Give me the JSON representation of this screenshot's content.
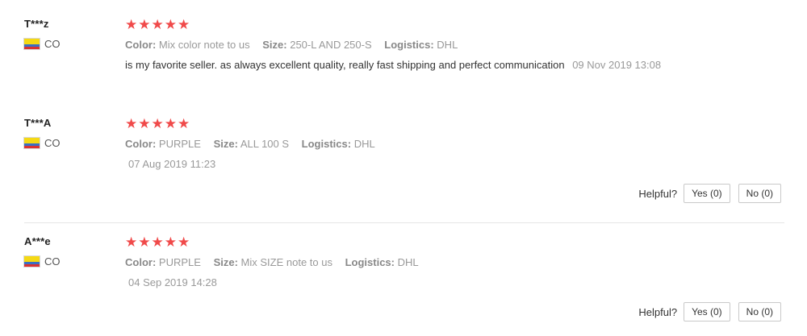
{
  "labels": {
    "color": "Color:",
    "size": "Size:",
    "logistics": "Logistics:",
    "helpful": "Helpful?"
  },
  "star_glyphs": "★★★★★",
  "colors": {
    "star": "#f04a4a",
    "meta_text": "#999999",
    "body_text": "#333333"
  },
  "reviews": [
    {
      "user": "T***z",
      "country": "CO",
      "rating": 5,
      "color": "Mix color note to us",
      "size": "250-L AND 250-S",
      "logistics": "DHL",
      "text": "is my favorite seller. as always excellent quality, really fast shipping and perfect communication",
      "date": "09 Nov 2019 13:08"
    },
    {
      "user": "T***A",
      "country": "CO",
      "rating": 5,
      "color": "PURPLE",
      "size": "ALL 100 S",
      "logistics": "DHL",
      "date": "07 Aug 2019 11:23",
      "yes": "Yes (0)",
      "no": "No (0)"
    },
    {
      "user": "A***e",
      "country": "CO",
      "rating": 5,
      "color": "PURPLE",
      "size": "Mix SIZE note to us",
      "logistics": "DHL",
      "date": "04 Sep 2019 14:28",
      "yes": "Yes (0)",
      "no": "No (0)"
    }
  ]
}
